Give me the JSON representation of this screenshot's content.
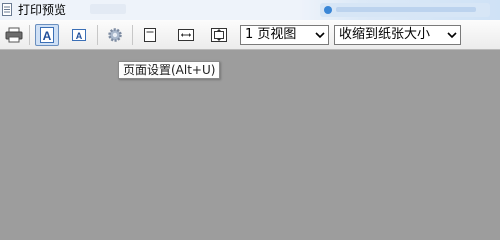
{
  "window": {
    "title": "打印预览"
  },
  "toolbar": {
    "buttons": [
      {
        "name": "print-button",
        "icon": "printer-icon"
      },
      {
        "name": "one-page-button",
        "icon": "page-a-large-icon",
        "active": true
      },
      {
        "name": "two-page-button",
        "icon": "page-a-small-icon"
      },
      {
        "name": "page-setup-button",
        "icon": "gear-icon"
      },
      {
        "name": "fit-page-button",
        "icon": "page-frame-icon"
      },
      {
        "name": "fit-width-button",
        "icon": "fit-width-icon"
      },
      {
        "name": "fit-full-button",
        "icon": "fit-full-icon"
      }
    ],
    "view_select": {
      "value": "1 页视图"
    },
    "zoom_select": {
      "value": "收缩到纸张大小"
    }
  },
  "tooltip": {
    "text": "页面设置(Alt+U)"
  }
}
